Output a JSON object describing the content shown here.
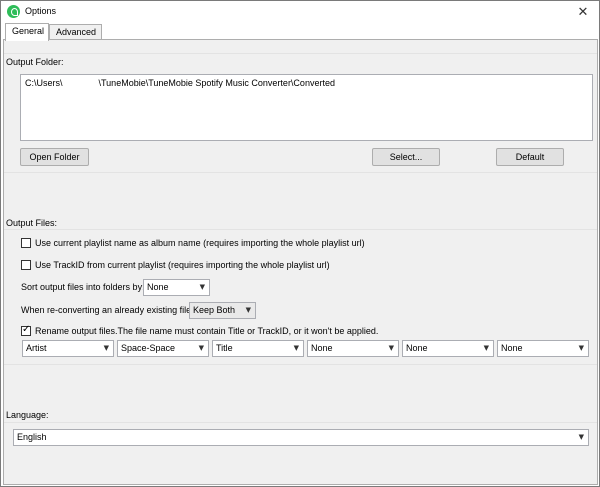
{
  "window": {
    "title": "Options",
    "close_glyph": "✕",
    "icon": "app-logo-icon"
  },
  "tabs": [
    {
      "label": "General",
      "active": true
    },
    {
      "label": "Advanced",
      "active": false
    }
  ],
  "output_folder": {
    "label": "Output Folder:",
    "path_prefix": "C:\\Users\\",
    "path_suffix": "\\TuneMobie\\TuneMobie Spotify Music Converter\\Converted",
    "open_button": "Open Folder",
    "select_button": "Select...",
    "default_button": "Default"
  },
  "output_files": {
    "label": "Output Files:",
    "use_playlist_name": {
      "label": "Use current playlist name as album name (requires importing the whole playlist url)",
      "checked": false
    },
    "use_trackid": {
      "label": "Use TrackID from current playlist (requires importing the whole playlist url)",
      "checked": false
    },
    "sort_label": "Sort output files into folders by:",
    "sort_value": "None",
    "reconvert_label": "When re-converting an already existing file:",
    "reconvert_value": "Keep Both",
    "rename": {
      "label": "Rename output files.The file name must contain Title or TrackID, or it won't be applied.",
      "checked": true
    },
    "rename_parts": [
      "Artist",
      "Space-Space",
      "Title",
      "None",
      "None",
      "None"
    ]
  },
  "language": {
    "label": "Language:",
    "value": "English"
  }
}
